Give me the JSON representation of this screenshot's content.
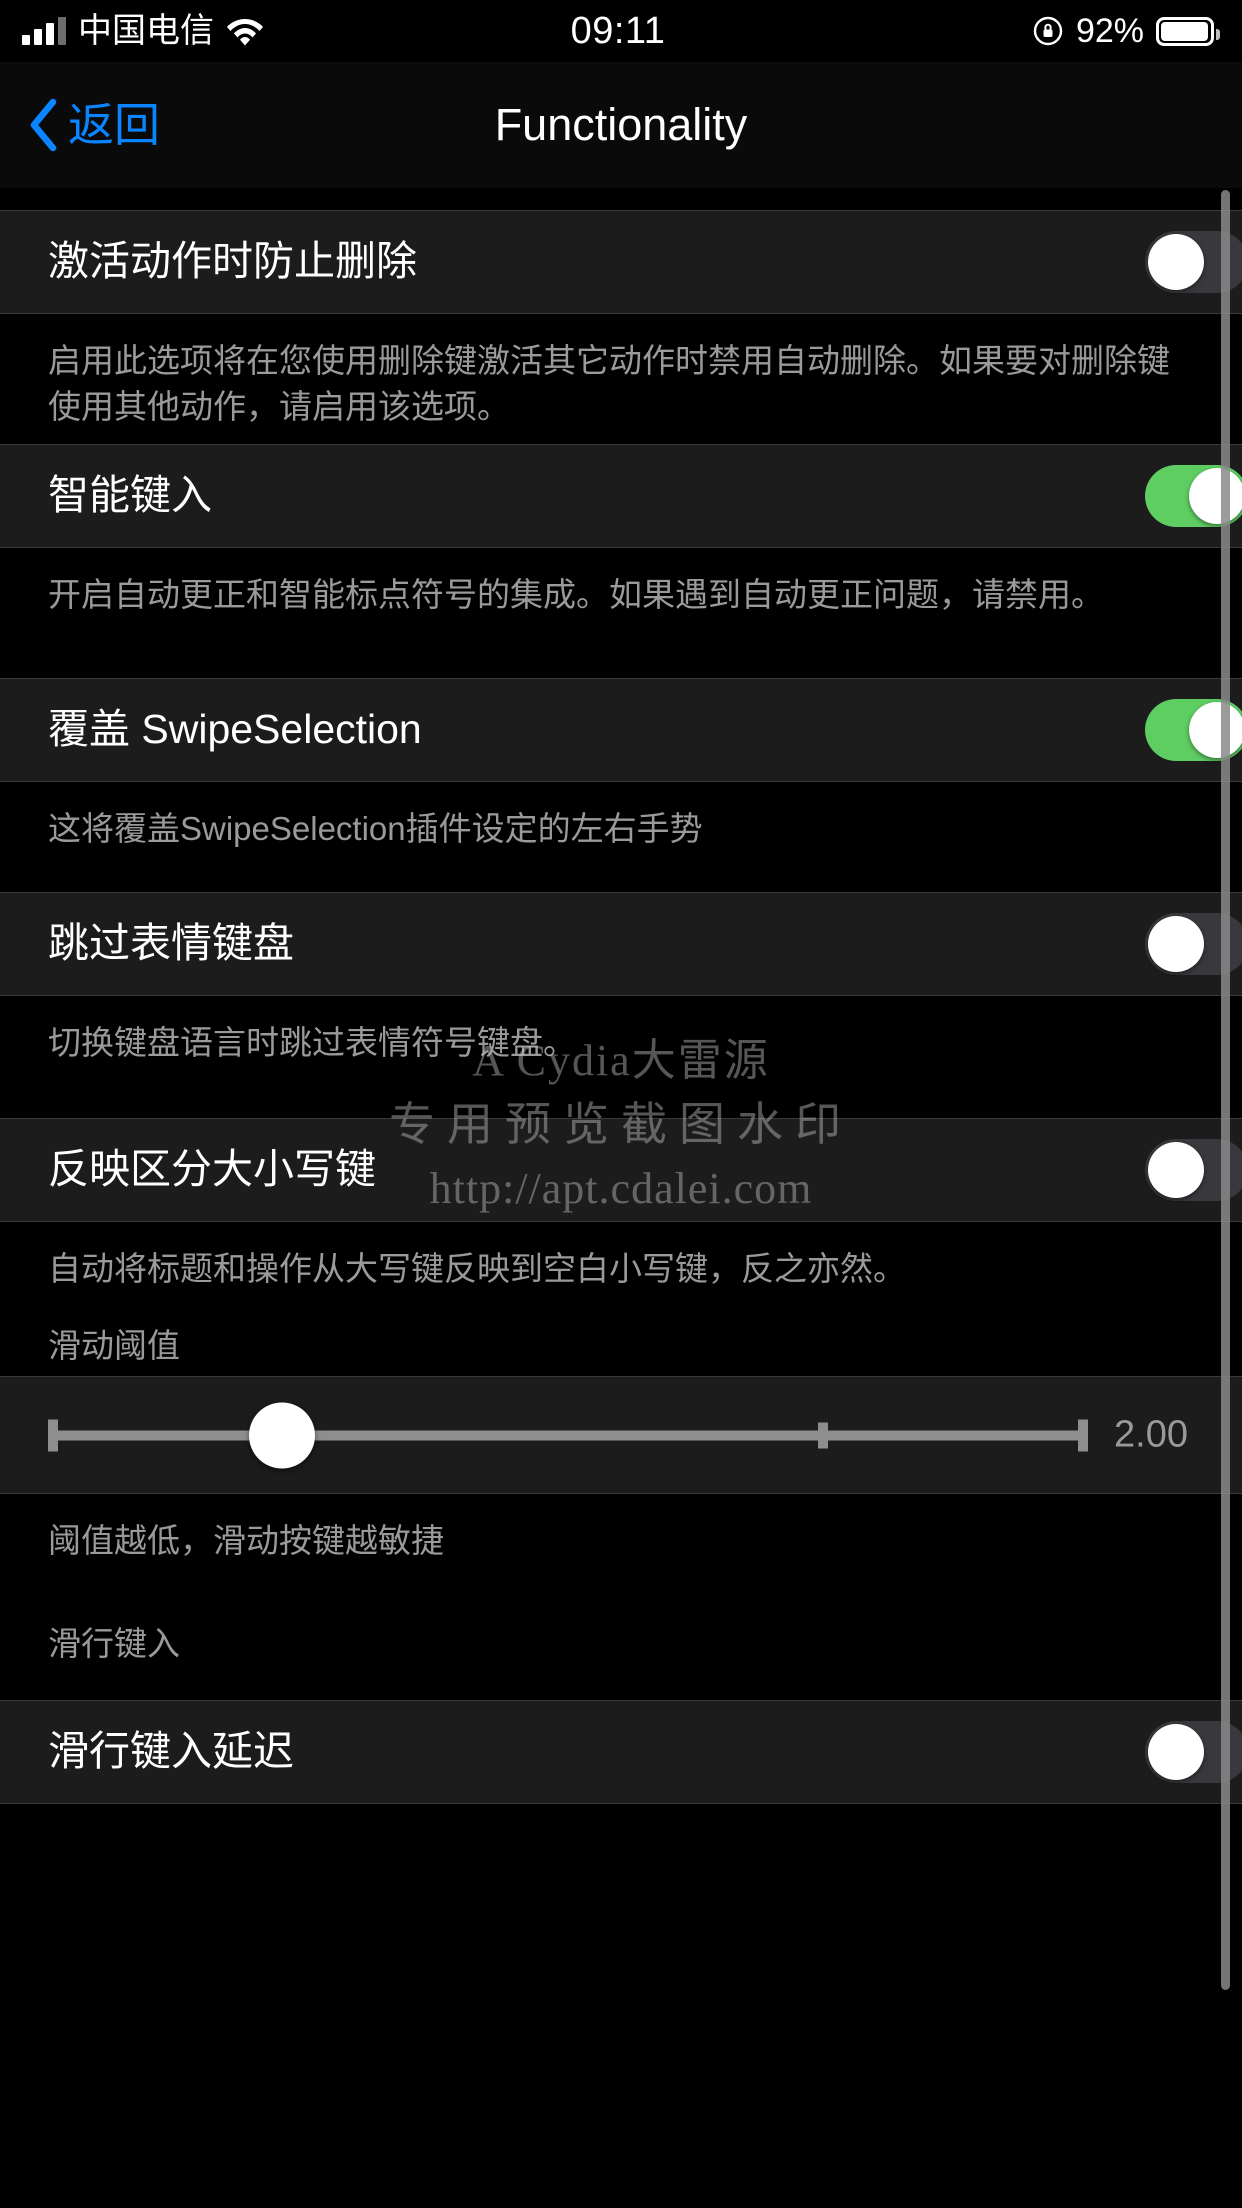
{
  "status_bar": {
    "carrier": "中国电信",
    "time": "09:11",
    "battery_percent": "92%",
    "signal_icon": "signal-bars-icon",
    "wifi_icon": "wifi-icon",
    "rotation_lock_icon": "rotation-lock-icon",
    "battery_icon": "battery-icon"
  },
  "nav": {
    "back_label": "返回",
    "back_icon": "chevron-left-icon",
    "title": "Functionality"
  },
  "rows": [
    {
      "title": "激活动作时防止删除",
      "toggle": "off",
      "footnote": "启用此选项将在您使用删除键激活其它动作时禁用自动删除。如果要对删除键使用其他动作，请启用该选项。"
    },
    {
      "title": "智能键入",
      "toggle": "on",
      "footnote": "开启自动更正和智能标点符号的集成。如果遇到自动更正问题，请禁用。"
    },
    {
      "title": "覆盖 SwipeSelection",
      "toggle": "on",
      "footnote": "这将覆盖SwipeSelection插件设定的左右手势"
    },
    {
      "title": "跳过表情键盘",
      "toggle": "off",
      "footnote": "切换键盘语言时跳过表情符号键盘。"
    },
    {
      "title": "反映区分大小写键",
      "toggle": "off",
      "footnote": "自动将标题和操作从大写键反映到空白小写键，反之亦然。"
    }
  ],
  "slider_section": {
    "header": "滑动阈值",
    "value": "2.00",
    "footnote": "阈值越低，滑动按键越敏捷"
  },
  "glide_section": {
    "header": "滑行键入",
    "row_title": "滑行键入延迟",
    "toggle": "off"
  },
  "watermark": {
    "line1": "A Cydia大雷源",
    "line2": "专用预览截图水印",
    "line3": "http://apt.cdalei.com"
  },
  "colors": {
    "accent_blue": "#0a84ff",
    "toggle_on_green": "#5ece63",
    "toggle_off_gray": "#39393d",
    "cell_background": "#1c1c1c",
    "page_background": "#000000",
    "secondary_text": "#9a9a9a"
  }
}
